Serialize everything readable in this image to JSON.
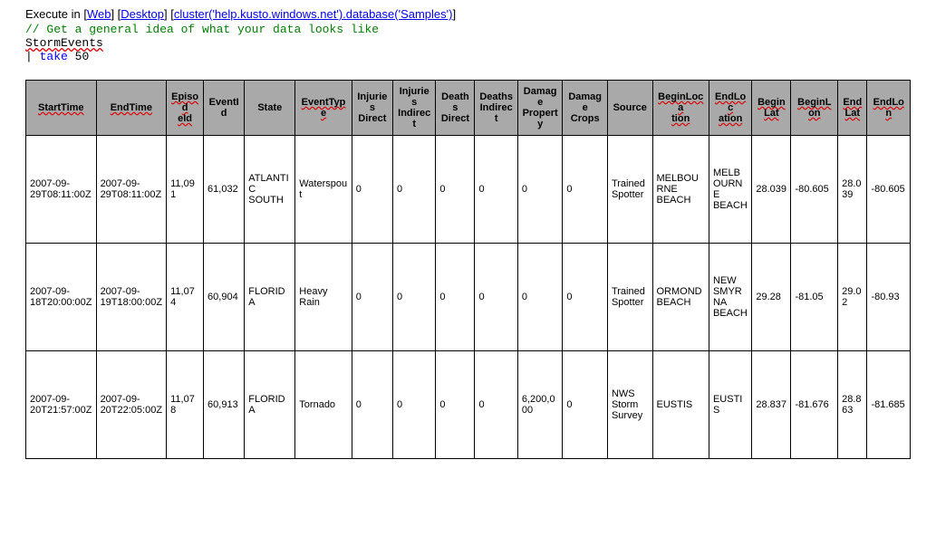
{
  "header": {
    "execute_label": "Execute in",
    "links": {
      "web": "Web",
      "desktop": "Desktop",
      "cluster": "cluster('help.kusto.windows.net').database('Samples')"
    }
  },
  "code": {
    "comment": "// Get a general idea of what your data looks like",
    "line2_ident": "StormEvents",
    "line3_pipe": "|",
    "line3_keyword": "take",
    "line3_number": "50"
  },
  "table": {
    "headers": [
      "StartTime",
      "EndTime",
      "EpisodeId",
      "EventId",
      "State",
      "EventType",
      "Injuries Direct",
      "Injuries Indirect",
      "Deaths Direct",
      "Deaths Indirect",
      "Damage Property",
      "Damage Crops",
      "Source",
      "BeginLocation",
      "EndLocation",
      "BeginLat",
      "BeginLon",
      "EndLat",
      "EndLon"
    ],
    "header_wavy": [
      true,
      true,
      true,
      false,
      false,
      true,
      false,
      false,
      false,
      false,
      false,
      false,
      false,
      true,
      true,
      true,
      true,
      true,
      true
    ],
    "header_breaks": {
      "2": [
        "Episod",
        "eId"
      ],
      "6": [
        "Injuries",
        "Direct"
      ],
      "7": [
        "Injuries",
        "Indirect"
      ],
      "8": [
        "Deaths",
        "Direct"
      ],
      "9": [
        "Deaths",
        "Indirect"
      ],
      "10": [
        "Damage",
        "Propert",
        "y"
      ],
      "11": [
        "Damage",
        "Crops"
      ],
      "13": [
        "BeginLoca",
        "tion"
      ],
      "14": [
        "EndLoc",
        "ation"
      ],
      "15": [
        "Begin",
        "Lat"
      ],
      "17": [
        "End",
        "Lat"
      ]
    },
    "rows": [
      {
        "StartTime": "2007-09-29T08:11:00Z",
        "EndTime": "2007-09-29T08:11:00Z",
        "EpisodeId": "11,091",
        "EventId": "61,032",
        "State": "ATLANTIC SOUTH",
        "EventType": "Waterspout",
        "InjuriesDirect": "0",
        "InjuriesIndirect": "0",
        "DeathsDirect": "0",
        "DeathsIndirect": "0",
        "DamageProperty": "0",
        "DamageCrops": "0",
        "Source": "Trained Spotter",
        "BeginLocation": "MELBOURNE BEACH",
        "EndLocation": "MELBOURNE BEACH",
        "BeginLat": "28.039",
        "BeginLon": "-80.605",
        "EndLat": "28.039",
        "EndLon": "-80.605"
      },
      {
        "StartTime": "2007-09-18T20:00:00Z",
        "EndTime": "2007-09-19T18:00:00Z",
        "EpisodeId": "11,074",
        "EventId": "60,904",
        "State": "FLORIDA",
        "EventType": "Heavy Rain",
        "InjuriesDirect": "0",
        "InjuriesIndirect": "0",
        "DeathsDirect": "0",
        "DeathsIndirect": "0",
        "DamageProperty": "0",
        "DamageCrops": "0",
        "Source": "Trained Spotter",
        "BeginLocation": "ORMOND BEACH",
        "EndLocation": "NEW SMYRNA BEACH",
        "BeginLat": "29.28",
        "BeginLon": "-81.05",
        "EndLat": "29.02",
        "EndLon": "-80.93"
      },
      {
        "StartTime": "2007-09-20T21:57:00Z",
        "EndTime": "2007-09-20T22:05:00Z",
        "EpisodeId": "11,078",
        "EventId": "60,913",
        "State": "FLORIDA",
        "EventType": "Tornado",
        "InjuriesDirect": "0",
        "InjuriesIndirect": "0",
        "DeathsDirect": "0",
        "DeathsIndirect": "0",
        "DamageProperty": "6,200,000",
        "DamageCrops": "0",
        "Source": "NWS Storm Survey",
        "BeginLocation": "EUSTIS",
        "EndLocation": "EUSTIS",
        "BeginLat": "28.837",
        "BeginLon": "-81.676",
        "EndLat": "28.863",
        "EndLon": "-81.685"
      }
    ]
  }
}
